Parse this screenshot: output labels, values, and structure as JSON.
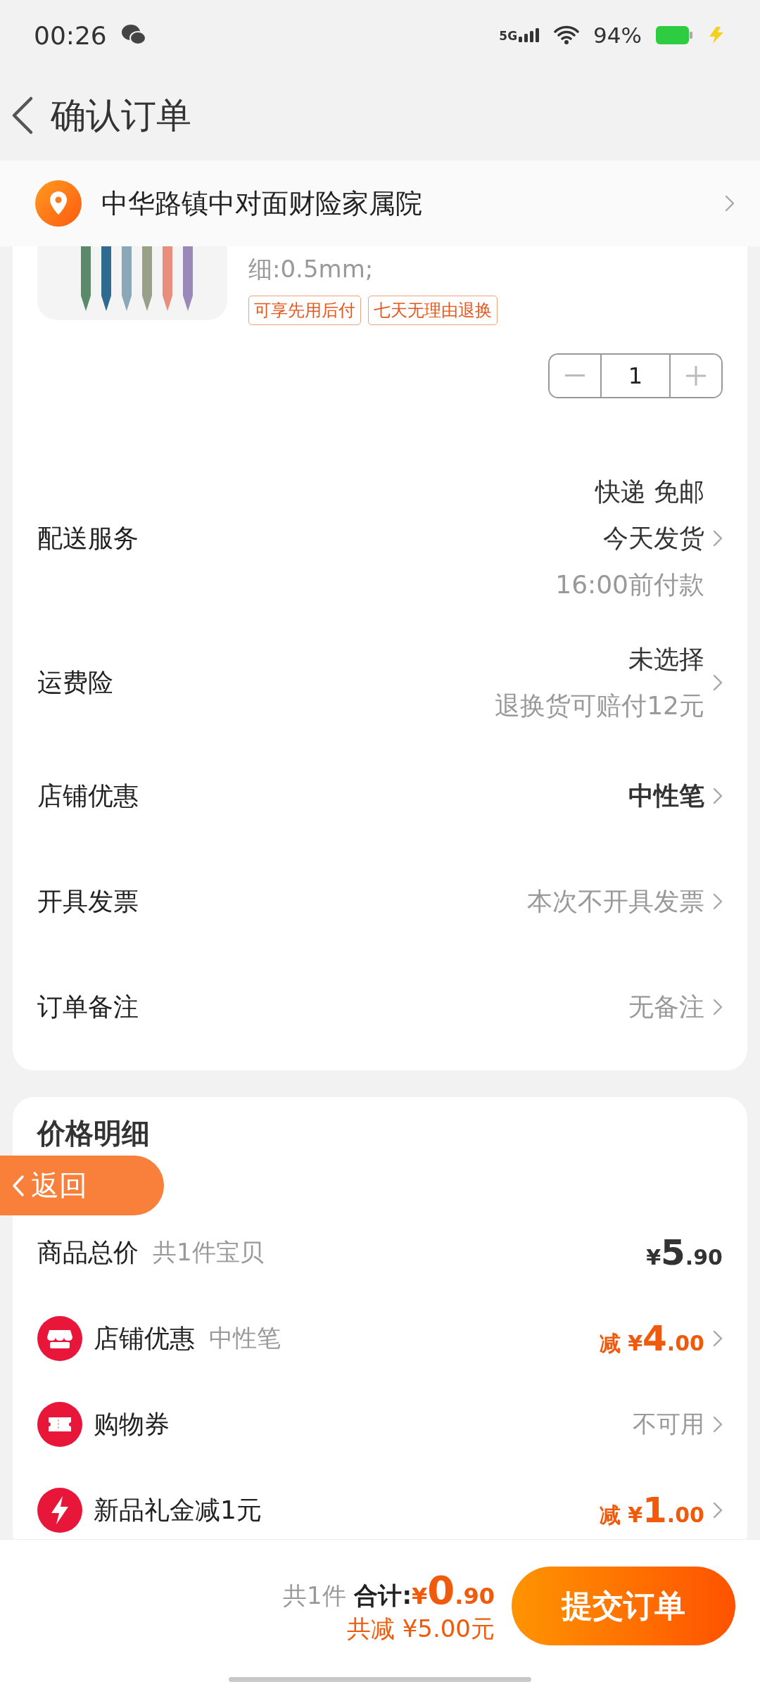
{
  "status_bar": {
    "time": "00:26",
    "network": "5G",
    "battery": "94%"
  },
  "header": {
    "title": "确认订单"
  },
  "address": {
    "text": "中华路镇中对面财险家属院"
  },
  "product": {
    "spec": "细:0.5mm;",
    "tags": [
      "可享先用后付",
      "七天无理由退换"
    ],
    "quantity": "1"
  },
  "order_rows": [
    {
      "label": "配送服务",
      "lines": [
        {
          "text": "快递 免邮",
          "kind": "strong"
        },
        {
          "text": "今天发货",
          "kind": "strong"
        },
        {
          "text": "16:00前付款",
          "kind": "muted"
        }
      ]
    },
    {
      "label": "运费险",
      "lines": [
        {
          "text": "未选择",
          "kind": "strong"
        },
        {
          "text": "退换货可赔付12元",
          "kind": "muted"
        }
      ]
    },
    {
      "label": "店铺优惠",
      "lines": [
        {
          "text": "中性笔",
          "kind": "bold"
        }
      ]
    },
    {
      "label": "开具发票",
      "lines": [
        {
          "text": "本次不开具发票",
          "kind": "muted"
        }
      ]
    },
    {
      "label": "订单备注",
      "lines": [
        {
          "text": "无备注",
          "kind": "muted"
        }
      ]
    }
  ],
  "price_detail": {
    "title": "价格明细",
    "rows": [
      {
        "kind": "total",
        "label": "商品总价",
        "sub": "共1件宝贝",
        "currency": "¥",
        "integer": "5",
        "decimal": ".90"
      },
      {
        "kind": "discount",
        "label": "店铺优惠",
        "sub": "中性笔",
        "prefix": "减",
        "currency": "¥",
        "integer": "4",
        "decimal": ".00"
      },
      {
        "kind": "text",
        "label": "购物券",
        "value": "不可用"
      },
      {
        "kind": "discount",
        "label": "新品礼金减1元",
        "prefix": "减",
        "currency": "¥",
        "integer": "1",
        "decimal": ".00"
      }
    ]
  },
  "back_button": {
    "label": "返回"
  },
  "bottom_bar": {
    "count": "共1件",
    "total_label": "合计:",
    "currency": "¥",
    "integer": "0",
    "decimal": ".90",
    "saved": "共减 ¥5.00元",
    "submit": "提交订单"
  }
}
